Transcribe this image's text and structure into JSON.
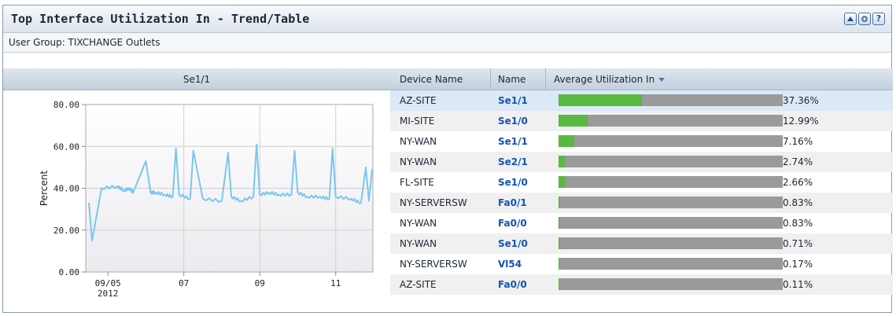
{
  "panel": {
    "title": "Top Interface Utilization In - Trend/Table",
    "group_label": "User Group: TIXCHANGE Outlets",
    "buttons": [
      "collapse-icon",
      "settings-icon",
      "help-icon"
    ],
    "help_glyph": "?"
  },
  "chart": {
    "header": "Se1/1"
  },
  "chart_data": {
    "type": "line",
    "ylabel": "Percent",
    "ylim": [
      0,
      80
    ],
    "yticks": [
      "80.00",
      "60.00",
      "40.00",
      "20.00",
      "0.00"
    ],
    "xticks": [
      "09/05",
      "07",
      "09",
      "11"
    ],
    "xtick_year": "2012",
    "series_color": "#7cc6ee",
    "series": [
      {
        "name": "",
        "x": [
          "09/04 12:00",
          "09/04 14:00",
          "09/04 20:00",
          "09/05 06:00",
          "09/05 10:00",
          "09/05 14:00",
          "09/05 16:00",
          "09/06 00:00",
          "09/06 03:00",
          "09/06 06:00",
          "09/06 12:00",
          "09/06 17:00",
          "09/06 19:00",
          "09/06 21:00",
          "09/07 04:00",
          "09/07 06:00",
          "09/07 12:00",
          "09/08 00:00",
          "09/08 04:00",
          "09/08 06:00",
          "09/08 12:00",
          "09/08 20:00",
          "09/08 22:00",
          "09/09 00:00",
          "09/09 06:00",
          "09/09 12:00",
          "09/09 20:00",
          "09/09 22:00",
          "09/10 00:00",
          "09/10 06:00",
          "09/10 14:00",
          "09/10 20:00",
          "09/10 22:00",
          "09/11 00:00",
          "09/11 10:00",
          "09/11 16:00",
          "09/11 19:00",
          "09/11 21:00",
          "09/11 23:00"
        ],
        "y": [
          33,
          15,
          40,
          41,
          39,
          40,
          38,
          53,
          38,
          38,
          37,
          36,
          59,
          37,
          35,
          58,
          35,
          34,
          57,
          36,
          34,
          36,
          61,
          37,
          38,
          37,
          37,
          58,
          38,
          36,
          36,
          35,
          59,
          36,
          35,
          33,
          50,
          34,
          49
        ]
      }
    ]
  },
  "table": {
    "headers": [
      "Device Name",
      "Name",
      "Average Utilization In"
    ],
    "rows": [
      {
        "device": "AZ-SITE",
        "name": "Se1/1",
        "util": 37.36,
        "label": "37.36%"
      },
      {
        "device": "MI-SITE",
        "name": "Se1/0",
        "util": 12.99,
        "label": "12.99%"
      },
      {
        "device": "NY-WAN",
        "name": "Se1/1",
        "util": 7.16,
        "label": "7.16%"
      },
      {
        "device": "NY-WAN",
        "name": "Se2/1",
        "util": 2.74,
        "label": "2.74%"
      },
      {
        "device": "FL-SITE",
        "name": "Se1/0",
        "util": 2.66,
        "label": "2.66%"
      },
      {
        "device": "NY-SERVERSW",
        "name": "Fa0/1",
        "util": 0.83,
        "label": "0.83%"
      },
      {
        "device": "NY-WAN",
        "name": "Fa0/0",
        "util": 0.83,
        "label": "0.83%"
      },
      {
        "device": "NY-WAN",
        "name": "Se1/0",
        "util": 0.71,
        "label": "0.71%"
      },
      {
        "device": "NY-SERVERSW",
        "name": "Vl54",
        "util": 0.17,
        "label": "0.17%"
      },
      {
        "device": "AZ-SITE",
        "name": "Fa0/0",
        "util": 0.11,
        "label": "0.11%"
      }
    ]
  }
}
